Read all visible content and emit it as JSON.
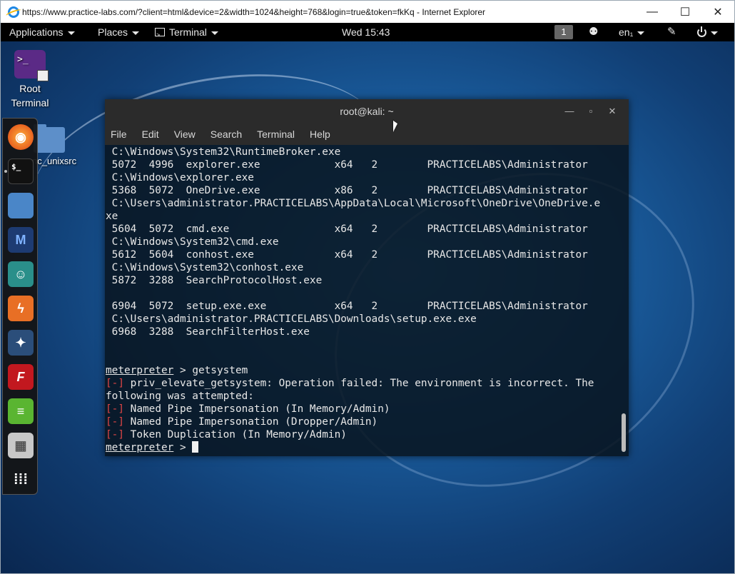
{
  "browser": {
    "title": "https://www.practice-labs.com/?client=html&device=2&width=1024&height=768&login=true&token=fkKq - Internet Explorer",
    "icon": "ie-logo-icon",
    "controls": {
      "minimize": "—",
      "maximize": "☐",
      "close": "✕"
    }
  },
  "panel": {
    "applications": "Applications",
    "places": "Places",
    "terminal": "Terminal",
    "clock": "Wed 15:43",
    "workspace": "1",
    "language": "en₁"
  },
  "desktop": {
    "icon_label": "Root Terminal",
    "icon_label_line1": "Root",
    "icon_label_line2": "Terminal",
    "icon_glyph": ">_",
    "folder_label": "nc_unixsrc"
  },
  "dock": {
    "items": [
      "firefox-icon",
      "terminal-icon",
      "files-icon",
      "metasploit-icon",
      "armitage-icon",
      "burpsuite-icon",
      "maltego-icon",
      "faraday-icon",
      "notes-icon",
      "settings-icon",
      "app-grid-icon"
    ],
    "terminal_glyph": "$_"
  },
  "terminal": {
    "title": "root@kali: ~",
    "controls": {
      "minimize": "—",
      "maximize": "▫",
      "close": "✕"
    },
    "menu": [
      "File",
      "Edit",
      "View",
      "Search",
      "Terminal",
      "Help"
    ],
    "lines": [
      " C:\\Windows\\System32\\RuntimeBroker.exe",
      " 5072  4996  explorer.exe            x64   2        PRACTICELABS\\Administrator",
      " C:\\Windows\\explorer.exe",
      " 5368  5072  OneDrive.exe            x86   2        PRACTICELABS\\Administrator",
      " C:\\Users\\administrator.PRACTICELABS\\AppData\\Local\\Microsoft\\OneDrive\\OneDrive.e",
      "xe",
      " 5604  5072  cmd.exe                 x64   2        PRACTICELABS\\Administrator",
      " C:\\Windows\\System32\\cmd.exe",
      " 5612  5604  conhost.exe             x64   2        PRACTICELABS\\Administrator",
      " C:\\Windows\\System32\\conhost.exe",
      " 5872  3288  SearchProtocolHost.exe",
      "",
      " 6904  5072  setup.exe.exe           x64   2        PRACTICELABS\\Administrator",
      " C:\\Users\\administrator.PRACTICELABS\\Downloads\\setup.exe.exe",
      " 6968  3288  SearchFilterHost.exe",
      "",
      ""
    ],
    "prompt": "meterpreter",
    "prompt_sep": " > ",
    "command": "getsystem",
    "error_tag": "[-]",
    "error_lines": [
      " priv_elevate_getsystem: Operation failed: The environment is incorrect. The",
      " Named Pipe Impersonation (In Memory/Admin)",
      " Named Pipe Impersonation (Dropper/Admin)",
      " Token Duplication (In Memory/Admin)"
    ],
    "continuation": "following was attempted:"
  }
}
